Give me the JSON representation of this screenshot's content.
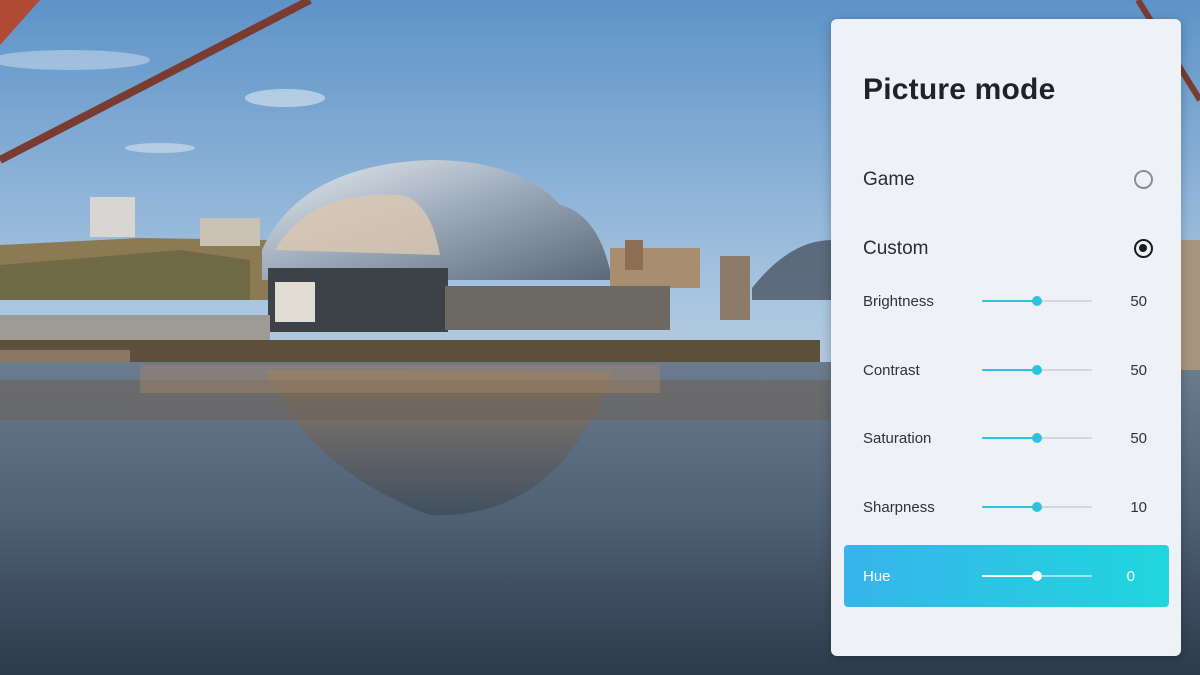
{
  "panel": {
    "title": "Picture mode",
    "modes": [
      {
        "label": "Game",
        "selected": false
      },
      {
        "label": "Custom",
        "selected": true
      }
    ],
    "sliders": [
      {
        "label": "Brightness",
        "value": "50",
        "level": 0.5
      },
      {
        "label": "Contrast",
        "value": "50",
        "level": 0.5
      },
      {
        "label": "Saturation",
        "value": "50",
        "level": 0.5
      },
      {
        "label": "Sharpness",
        "value": "10",
        "level": 0.5
      },
      {
        "label": "Hue",
        "value": "0",
        "level": 0.5,
        "focused": true
      }
    ]
  },
  "colors": {
    "accent": "#2ec3dd",
    "focus_gradient_start": "#37b4ec",
    "focus_gradient_end": "#20d6dc",
    "panel_bg": "#eef1f5"
  }
}
